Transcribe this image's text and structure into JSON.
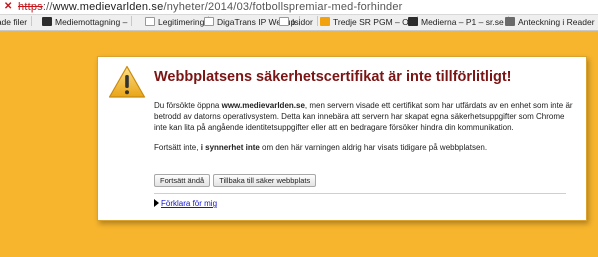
{
  "url_bar": {
    "scheme": "https",
    "rest": "://",
    "host": "www.medievarlden.se",
    "path": "/nyheter/2014/03/fotbollspremiar-med-forhinder"
  },
  "bookmarks": [
    {
      "label": "rade filer",
      "icon": "bookmark-icon"
    },
    {
      "label": "Mediemottagning –",
      "icon": "bookmark-icon"
    },
    {
      "label": "Legitimering",
      "icon": "page-icon"
    },
    {
      "label": "DigaTrans IP Webup",
      "icon": "page-icon"
    },
    {
      "label": "Isidor",
      "icon": "page-icon"
    },
    {
      "label": "Tredje SR PGM – Ou",
      "icon": "sr-icon"
    },
    {
      "label": "Medierna – P1 – sr.se",
      "icon": "bookmark-icon"
    },
    {
      "label": "Anteckning i Reader",
      "icon": "reader-icon"
    }
  ],
  "warning": {
    "icon": "warning-triangle-icon",
    "title": "Webbplatsens säkerhetscertifikat är inte tillförlitligt!",
    "p1_before": "Du försökte öppna ",
    "p1_host": "www.medievarlden.se",
    "p1_after": ", men servern visade ett certifikat som har utfärdats av en enhet som inte är betrodd av datorns operativsystem. Detta kan innebära att servern har skapat egna säkerhetsuppgifter som Chrome inte kan lita på angående identitetsuppgifter eller att en bedragare försöker hindra din kommunikation.",
    "p2_before": "Fortsätt inte, ",
    "p2_bold": "i synnerhet inte",
    "p2_after": " om den här varningen aldrig har visats tidigare på webbplatsen.",
    "proceed_label": "Fortsätt ändå",
    "back_label": "Tillbaka till säker webbplats",
    "explain_label": "Förklara för mig"
  },
  "colors": {
    "background": "#f7b52d",
    "title": "#7b1414",
    "link": "#1515d6",
    "scheme_error": "#c0161c"
  }
}
